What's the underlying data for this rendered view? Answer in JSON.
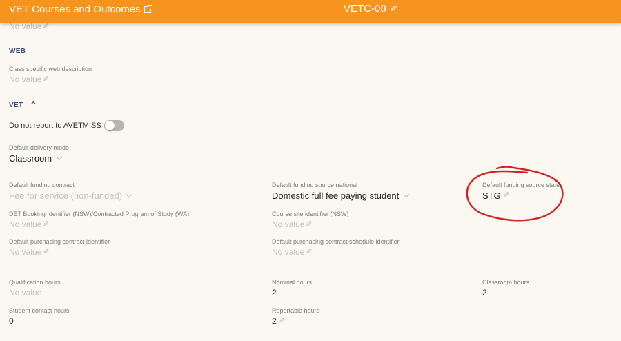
{
  "header": {
    "title": "VET Courses and Outcomes",
    "code": "VETC-08"
  },
  "top": {
    "truncated_value": "No value"
  },
  "web": {
    "section_title": "WEB",
    "field": {
      "label": "Class specific web description",
      "value": "No value"
    }
  },
  "vet": {
    "section_title": "VET",
    "toggle_label": "Do not report to AVETMISS",
    "toggle_on": false,
    "delivery_mode": {
      "label": "Default delivery mode",
      "value": "Classroom"
    },
    "funding_contract": {
      "label": "Default funding contract",
      "value": "Fee for service (non-funded)"
    },
    "funding_source_national": {
      "label": "Default funding source national",
      "value": "Domestic full fee paying student"
    },
    "funding_source_state": {
      "label": "Default funding source state",
      "value": "STG"
    },
    "det_booking": {
      "label": "DET Booking Identifier (NSW)/Contracted Program of Study (WA)",
      "value": "No value"
    },
    "course_site": {
      "label": "Course site identifier (NSW)",
      "value": "No value"
    },
    "purchasing_contract": {
      "label": "Default purchasing contract identifier",
      "value": "No value"
    },
    "purchasing_schedule": {
      "label": "Default purchasing contract schedule identifier",
      "value": "No value"
    },
    "qualification_hours": {
      "label": "Qualification hours",
      "value": "No value"
    },
    "nominal_hours": {
      "label": "Nominal hours",
      "value": "2"
    },
    "classroom_hours": {
      "label": "Classroom hours",
      "value": "2"
    },
    "student_contact_hours": {
      "label": "Student contact hours",
      "value": "0"
    },
    "reportable_hours": {
      "label": "Reportable hours",
      "value": "2"
    }
  },
  "colors": {
    "header_bg": "#f6941e",
    "section_title": "#3b4a7a",
    "annotation": "#d42020"
  },
  "icons": [
    "external-link-icon",
    "pencil-icon",
    "chevron-up-icon",
    "chevron-down-icon"
  ]
}
